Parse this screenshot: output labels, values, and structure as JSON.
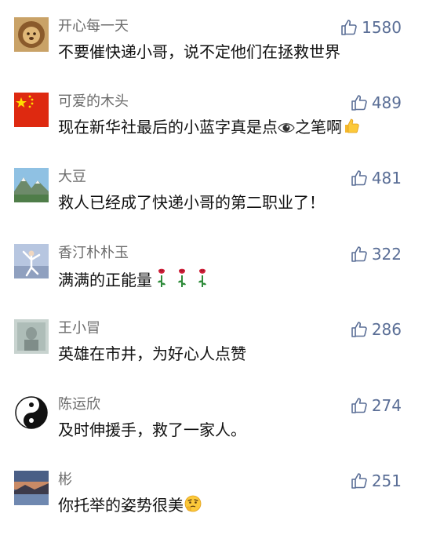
{
  "comments": [
    {
      "name": "开心每一天",
      "text": "不要催快递小哥，说不定他们在拯救世界",
      "likes": "1580",
      "text_suffix": ""
    },
    {
      "name": "可爱的木头",
      "text": "现在新华社最后的小蓝字真是点",
      "text_suffix": "之笔啊",
      "likes": "489"
    },
    {
      "name": "大豆",
      "text": "救人已经成了快递小哥的第二职业了！",
      "text_suffix": "",
      "likes": "481"
    },
    {
      "name": "香汀朴朴玉",
      "text": "满满的正能量",
      "text_suffix": "",
      "likes": "322"
    },
    {
      "name": "王小冒",
      "text": "英雄在市井，为好心人点赞",
      "text_suffix": "",
      "likes": "286"
    },
    {
      "name": "陈运欣",
      "text": "及时伸援手，救了一家人。",
      "text_suffix": "",
      "likes": "274"
    },
    {
      "name": "彬",
      "text": "你托举的姿势很美",
      "text_suffix": "",
      "likes": "251"
    }
  ],
  "icons": {
    "like": "thumbs-up-outline-icon",
    "eye": "eye-emoji-icon",
    "thumbs": "thumbs-up-emoji-icon",
    "rose": "rose-emoji-icon",
    "thinking": "thinking-face-emoji-icon"
  },
  "colors": {
    "name": "#6b6b6b",
    "text": "#111111",
    "like": "#5a6e96"
  }
}
